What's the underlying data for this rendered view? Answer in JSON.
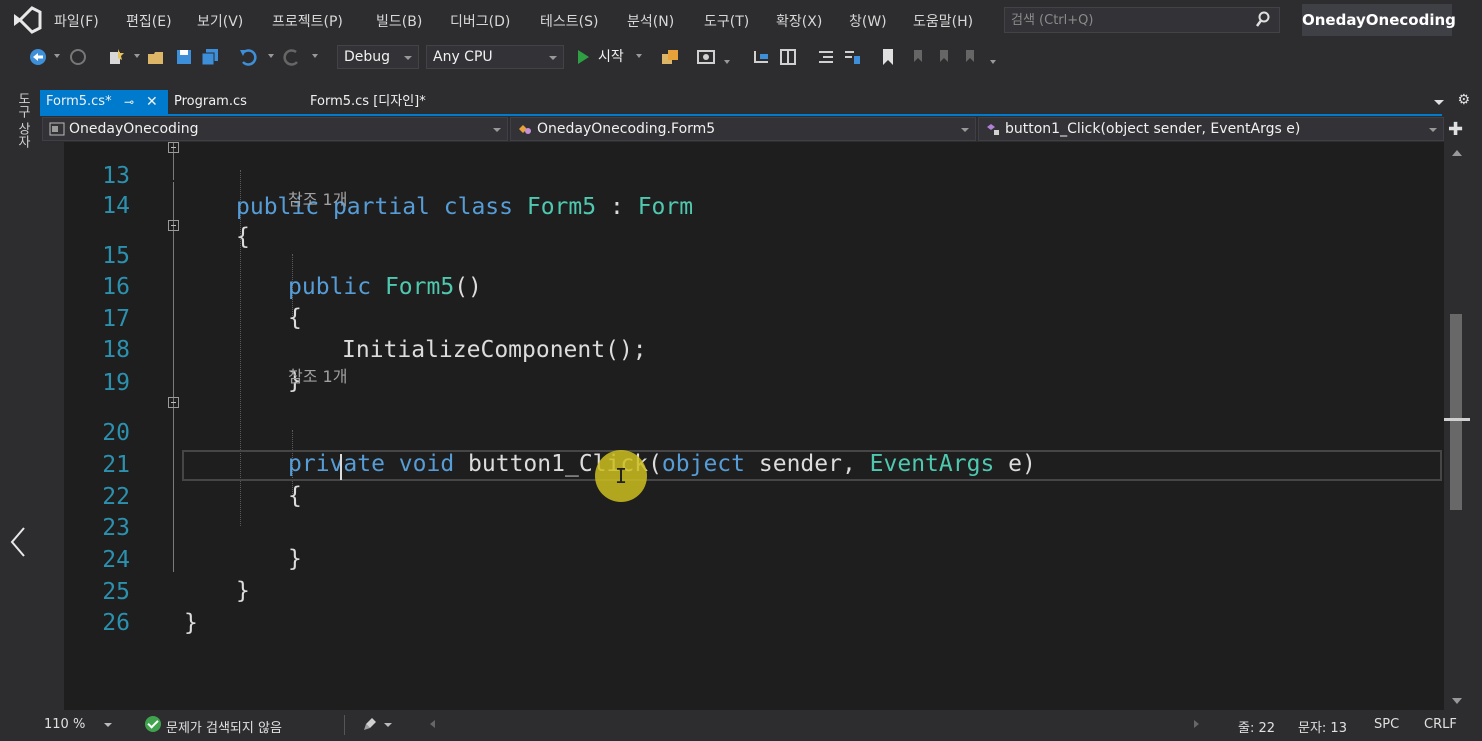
{
  "menubar": {
    "items": [
      "파일(F)",
      "편집(E)",
      "보기(V)",
      "프로젝트(P)",
      "빌드(B)",
      "디버그(D)",
      "테스트(S)",
      "분석(N)",
      "도구(T)",
      "확장(X)",
      "창(W)",
      "도움말(H)"
    ],
    "search_placeholder": "검색 (Ctrl+Q)",
    "solution_name": "OnedayOnecoding"
  },
  "toolbar": {
    "config": "Debug",
    "platform": "Any CPU",
    "start_label": "시작"
  },
  "side_strip": {
    "label": "도구 상자"
  },
  "tabs": [
    {
      "label": "Form5.cs*",
      "active": true
    },
    {
      "label": "Program.cs",
      "active": false
    },
    {
      "label": "Form5.cs [디자인]*",
      "active": false
    }
  ],
  "navbar": {
    "project": "OnedayOnecoding",
    "type": "OnedayOnecoding.Form5",
    "member": "button1_Click(object sender, EventArgs e)"
  },
  "editor": {
    "references_label": "참조 1개",
    "lines": [
      {
        "num": "13",
        "code": "    public partial class Form5 : Form"
      },
      {
        "num": "14",
        "code": "    {"
      },
      {
        "num": "15",
        "code": "        public Form5()"
      },
      {
        "num": "16",
        "code": "        {"
      },
      {
        "num": "17",
        "code": "            InitializeComponent();"
      },
      {
        "num": "18",
        "code": "        }"
      },
      {
        "num": "19",
        "code": ""
      },
      {
        "num": "20",
        "code": "        private void button1_Click(object sender, EventArgs e)"
      },
      {
        "num": "21",
        "code": "        {"
      },
      {
        "num": "22",
        "code": ""
      },
      {
        "num": "23",
        "code": "        }"
      },
      {
        "num": "24",
        "code": "    }"
      },
      {
        "num": "25",
        "code": "}"
      },
      {
        "num": "26",
        "code": ""
      }
    ],
    "tokens": {
      "public": "public",
      "partial": "partial",
      "class": "class",
      "form5": "Form5",
      "colon": ":",
      "form": "Form",
      "private": "private",
      "void": "void",
      "method": "button1_Click",
      "object": "object",
      "sender": "sender,",
      "eventargs": "EventArgs",
      "e": "e)",
      "paren_open": "(",
      "ctor_parens": "()",
      "init": "InitializeComponent();",
      "brace_open": "{",
      "brace_close": "}"
    }
  },
  "statusbar": {
    "zoom": "110 %",
    "issues": "문제가 검색되지 않음",
    "line": "줄: 22",
    "column": "문자: 13",
    "insert_mode": "SPC",
    "line_ending": "CRLF"
  },
  "colors": {
    "accent": "#007acc",
    "keyword": "#569cd6",
    "type": "#4ec9b0",
    "line_number": "#2b91af",
    "cursor_marker": "#ccbe1e"
  }
}
